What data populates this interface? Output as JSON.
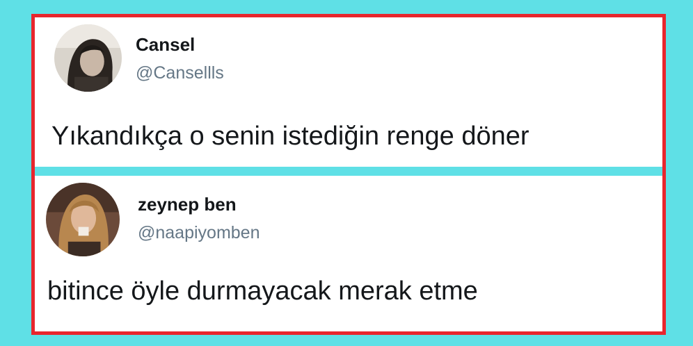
{
  "tweets": [
    {
      "display_name": "Cansel",
      "handle": "@Cansellls",
      "text": "Yıkandıkça o senin istediğin renge döner",
      "avatar_icon": "profile-photo-dark-hair"
    },
    {
      "display_name": "zeynep ben",
      "handle": "@naapiyomben",
      "text": "bitince öyle durmayacak merak etme",
      "avatar_icon": "profile-photo-blonde-hair"
    }
  ],
  "colors": {
    "background": "#5fe0e6",
    "frame_border": "#e8262d",
    "card": "#ffffff",
    "name": "#14171a",
    "handle": "#657786"
  }
}
